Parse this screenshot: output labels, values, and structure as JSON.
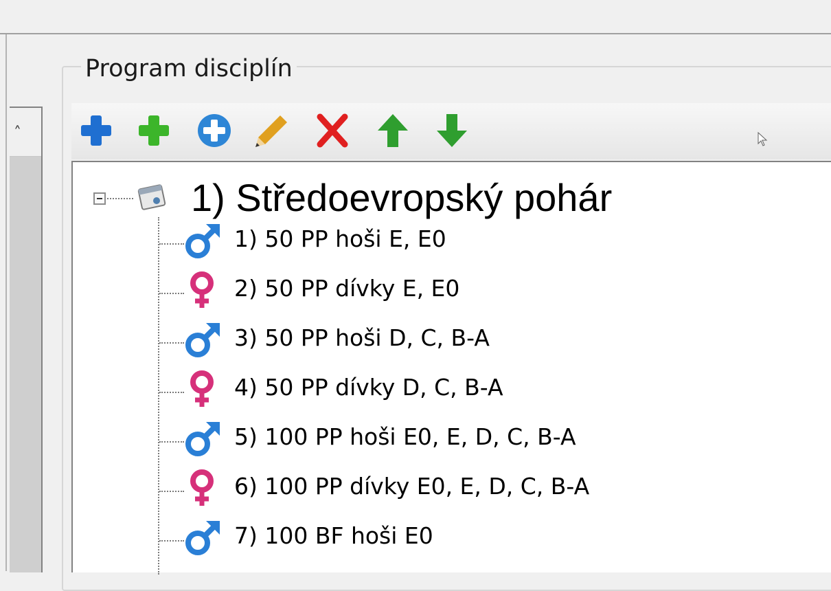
{
  "group": {
    "title": "Program disciplín"
  },
  "toolbar": {
    "buttons": [
      {
        "icon": "plus-blue-icon",
        "color": "#1f6fd1"
      },
      {
        "icon": "plus-green-icon",
        "color": "#3cb52a"
      },
      {
        "icon": "plus-circle-icon",
        "color": "#2e86d6"
      },
      {
        "icon": "pencil-icon",
        "color": "#e0a020"
      },
      {
        "icon": "delete-x-icon",
        "color": "#e02020"
      },
      {
        "icon": "arrow-up-icon",
        "color": "#2f9e2f"
      },
      {
        "icon": "arrow-down-icon",
        "color": "#2f9e2f"
      }
    ]
  },
  "tree": {
    "root": {
      "label": "1) Středoevropský pohár",
      "expanded": true
    },
    "items": [
      {
        "label": "1) 50 PP hoši E, E0",
        "gender": "male"
      },
      {
        "label": "2) 50 PP dívky E, E0",
        "gender": "female"
      },
      {
        "label": "3) 50 PP hoši D, C, B-A",
        "gender": "male"
      },
      {
        "label": "4) 50 PP dívky D, C, B-A",
        "gender": "female"
      },
      {
        "label": "5) 100 PP hoši E0, E, D, C, B-A",
        "gender": "male"
      },
      {
        "label": "6) 100 PP dívky E0, E, D, C, B-A",
        "gender": "female"
      },
      {
        "label": "7) 100 BF hoši E0",
        "gender": "male"
      }
    ]
  },
  "colors": {
    "male": "#2a7fd6",
    "female": "#d6307a"
  }
}
